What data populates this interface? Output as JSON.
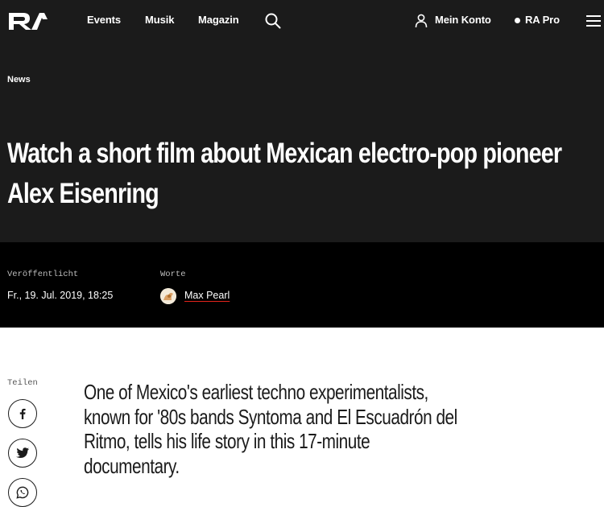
{
  "nav": {
    "logo": "RA",
    "items": [
      {
        "label": "Events"
      },
      {
        "label": "Musik"
      },
      {
        "label": "Magazin"
      }
    ],
    "account_label": "Mein Konto",
    "pro_label": "RA Pro"
  },
  "article": {
    "category": "News",
    "title": "Watch a short film about Mexican electro-pop pioneer Alex Eisenring",
    "published_label": "Veröffentlicht",
    "published_value": "Fr., 19. Jul. 2019, 18:25",
    "words_label": "Worte",
    "author": "Max Pearl",
    "share_label": "Teilen",
    "lead": "One of Mexico's earliest techno experimentalists, known for '80s bands Syntoma and El Escuadrón del Ritmo, tells his life story in this 17-minute documentary."
  },
  "colors": {
    "header_bg": "#1b1b1b",
    "meta_bg": "#000000",
    "accent": "#e3241b"
  },
  "icons": [
    "ra-logo-icon",
    "search-icon",
    "user-icon",
    "menu-icon",
    "facebook-icon",
    "twitter-icon",
    "whatsapp-icon"
  ]
}
